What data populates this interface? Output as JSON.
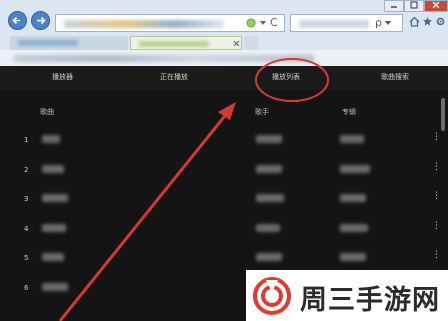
{
  "nav": {
    "items": [
      {
        "label": "播放器"
      },
      {
        "label": "正在播放"
      },
      {
        "label": "播放列表"
      },
      {
        "label": "歌曲搜索"
      }
    ]
  },
  "table": {
    "headers": {
      "song": "歌曲",
      "artist": "歌手",
      "album": "专辑"
    },
    "rows": [
      {
        "num": "1"
      },
      {
        "num": "2"
      },
      {
        "num": "3"
      },
      {
        "num": "4"
      },
      {
        "num": "5"
      },
      {
        "num": "6"
      }
    ],
    "more_glyph": "⋮"
  },
  "watermark": {
    "text": "周三手游网"
  },
  "browser": {
    "back_icon": "arrow-left-icon",
    "forward_icon": "arrow-right-icon",
    "refresh_glyph": "C",
    "search_glyph": "ρ"
  },
  "colors": {
    "app_background": "#141414",
    "nav_background": "#1b1b1b",
    "highlight_circle": "#d23b33",
    "annotation_arrow": "#d23b33",
    "watermark_red": "#e23a2c"
  }
}
